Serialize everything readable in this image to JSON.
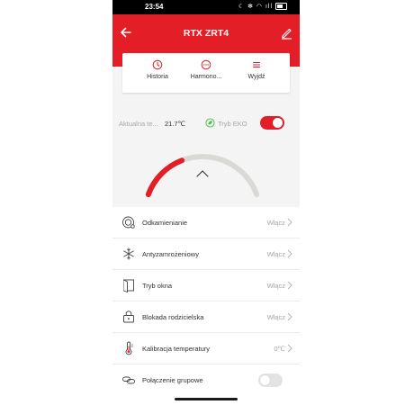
{
  "status_bar": {
    "time": "23:54",
    "icons": "☾ ✻ ◠ ıll"
  },
  "header": {
    "title": "RTX ZRT4"
  },
  "menu": {
    "items": [
      {
        "label": "Historia",
        "icon": "clock-icon"
      },
      {
        "label": "Harmono...",
        "icon": "dots-icon"
      },
      {
        "label": "Wyjdź",
        "icon": "hamburger-icon"
      }
    ]
  },
  "temperature": {
    "label": "Aktualna te...",
    "value": "21.7℃",
    "eko_label": "Tryb EKO",
    "eko_on": true
  },
  "gauge": {
    "level": 0.35
  },
  "list": {
    "rows": [
      {
        "name": "Odkamienianie",
        "value": "Włącz",
        "icon": "descale-icon"
      },
      {
        "name": "Antyzamrożeniowy",
        "value": "Włącz",
        "icon": "snowflake-icon"
      },
      {
        "name": "Tryb okna",
        "value": "Włącz",
        "icon": "window-icon"
      },
      {
        "name": "Blokada rodzicielska",
        "value": "Włącz",
        "icon": "lock-icon"
      },
      {
        "name": "Kalibracja temperatury",
        "value": "0℃",
        "icon": "thermometer-icon"
      },
      {
        "name": "Połączenie grupowe",
        "value": "",
        "icon": "link-icon"
      }
    ]
  },
  "colors": {
    "accent": "#e41e26",
    "gauge_track": "#d9d9d6",
    "eko_green": "#3fbf3f"
  }
}
